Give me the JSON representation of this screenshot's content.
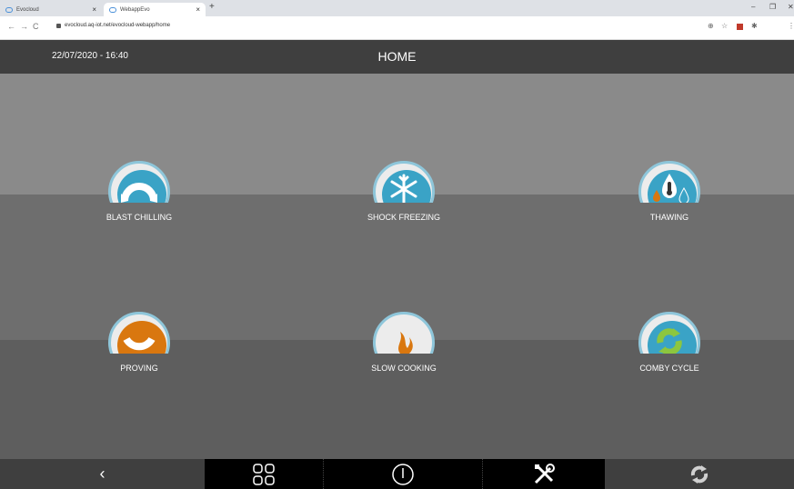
{
  "browser": {
    "tabs": [
      {
        "title": "Evocloud",
        "active": false
      },
      {
        "title": "WebappEvo",
        "active": true
      }
    ],
    "url": "evocloud.aq-iot.net/evocloud-webapp/home",
    "new_tab": "+",
    "close": "×"
  },
  "header": {
    "datetime": "22/07/2020 - 16:40",
    "title": "HOME"
  },
  "programs": [
    {
      "label": "BLAST CHILLING",
      "icon": "blast-chilling-icon"
    },
    {
      "label": "SHOCK FREEZING",
      "icon": "shock-freezing-icon"
    },
    {
      "label": "THAWING",
      "icon": "thawing-icon"
    },
    {
      "label": "PROVING",
      "icon": "proving-icon"
    },
    {
      "label": "SLOW COOKING",
      "icon": "slow-cooking-icon"
    },
    {
      "label": "COMBY CYCLE",
      "icon": "comby-cycle-icon"
    }
  ],
  "bottom_bar": {
    "back": "‹",
    "items": [
      "back-icon",
      "grid-menu-icon",
      "power-icon",
      "tools-icon",
      "cycle-icon"
    ]
  },
  "colors": {
    "header": "#3f3f3f",
    "accent_blue": "#3aa3c6",
    "accent_orange": "#d9770f",
    "accent_green": "#8cc63f"
  }
}
